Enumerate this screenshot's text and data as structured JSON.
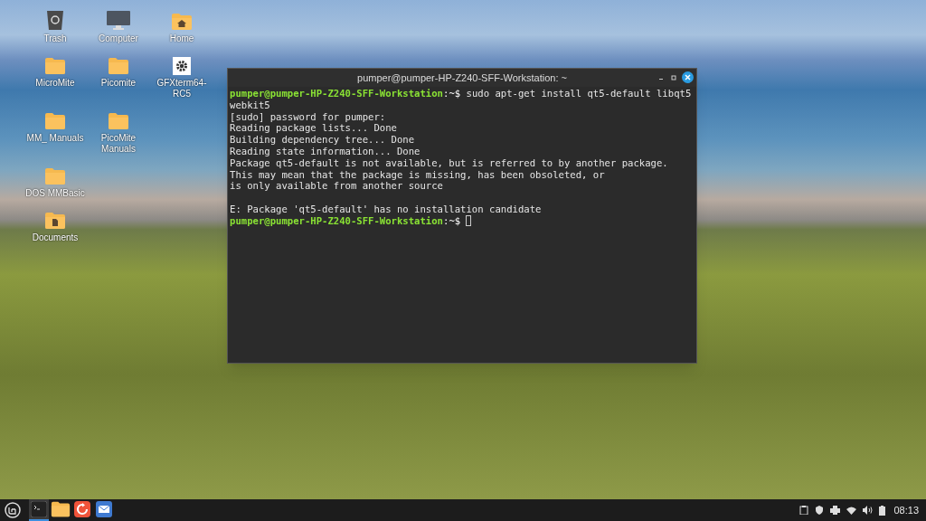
{
  "desktop_icons": [
    {
      "label": "Trash",
      "kind": "trash"
    },
    {
      "label": "Computer",
      "kind": "computer"
    },
    {
      "label": "Home",
      "kind": "home"
    },
    {
      "label": "MicroMite",
      "kind": "folder"
    },
    {
      "label": "Picomite",
      "kind": "folder"
    },
    {
      "label": "GFXterm64-RC5",
      "kind": "app"
    },
    {
      "label": "MM_ Manuals",
      "kind": "folder"
    },
    {
      "label": "PicoMite Manuals",
      "kind": "folder"
    },
    {
      "label": "DOS MMBasic",
      "kind": "folder"
    },
    {
      "label": "Documents",
      "kind": "documents"
    }
  ],
  "terminal": {
    "title": "pumper@pumper-HP-Z240-SFF-Workstation: ~",
    "lines": [
      {
        "kind": "prompt",
        "user": "pumper@pumper-HP-Z240-SFF-Workstation",
        "path": ":~$",
        "command": " sudo apt-get install qt5-default libqt5"
      },
      {
        "kind": "output",
        "text": "webkit5"
      },
      {
        "kind": "output",
        "text": "[sudo] password for pumper:"
      },
      {
        "kind": "output",
        "text": "Reading package lists... Done"
      },
      {
        "kind": "output",
        "text": "Building dependency tree... Done"
      },
      {
        "kind": "output",
        "text": "Reading state information... Done"
      },
      {
        "kind": "output",
        "text": "Package qt5-default is not available, but is referred to by another package."
      },
      {
        "kind": "output",
        "text": "This may mean that the package is missing, has been obsoleted, or"
      },
      {
        "kind": "output",
        "text": "is only available from another source"
      },
      {
        "kind": "blank"
      },
      {
        "kind": "output",
        "text": "E: Package 'qt5-default' has no installation candidate"
      },
      {
        "kind": "prompt",
        "user": "pumper@pumper-HP-Z240-SFF-Workstation",
        "path": ":~$",
        "cursor": true
      }
    ]
  },
  "taskbar": {
    "apps": [
      {
        "kind": "terminal",
        "selected": true
      },
      {
        "kind": "files",
        "selected": false
      },
      {
        "kind": "firefox",
        "selected": false
      },
      {
        "kind": "mail",
        "selected": false
      }
    ],
    "clock": "08:13"
  }
}
